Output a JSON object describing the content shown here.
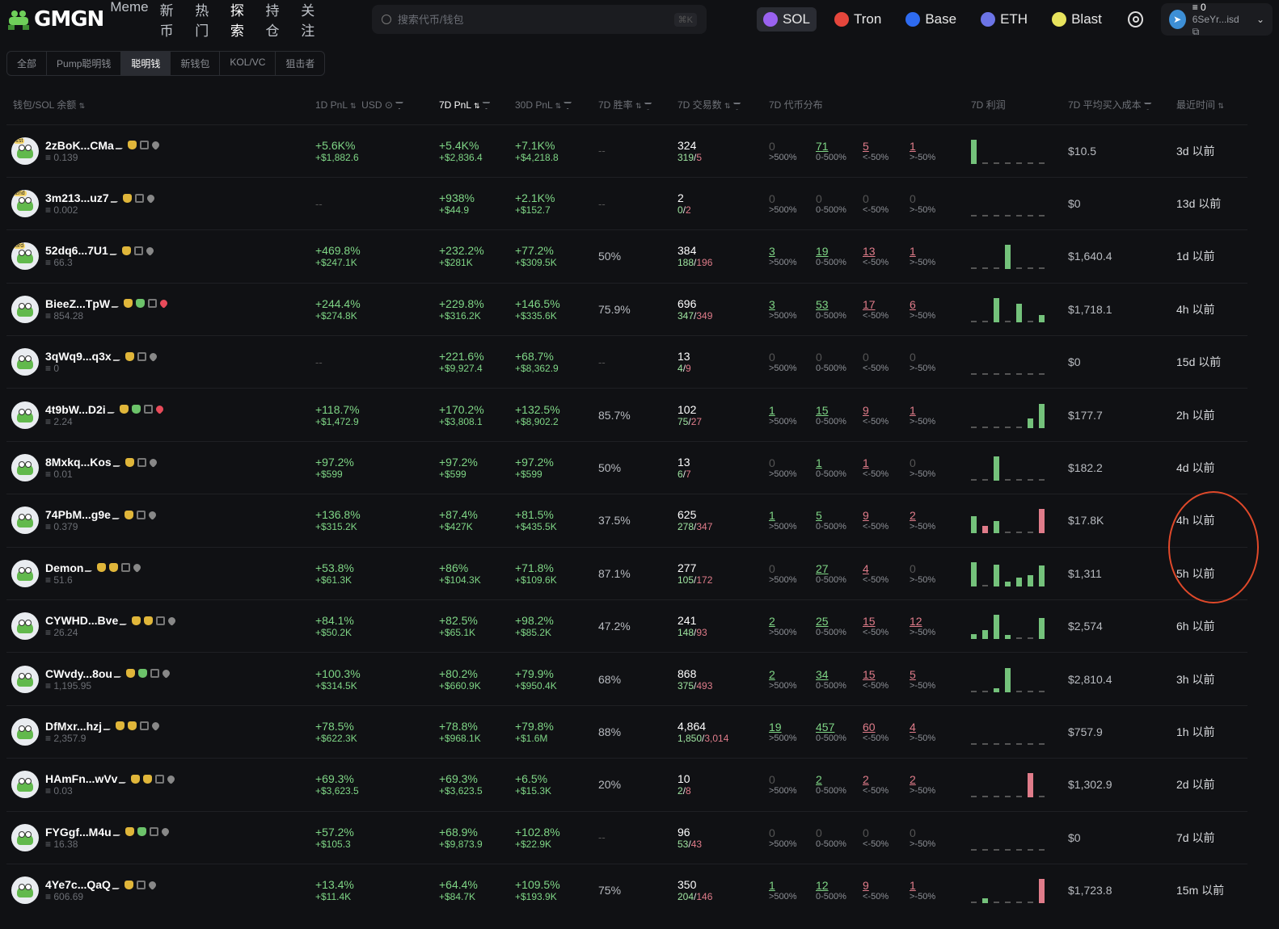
{
  "brand": {
    "name": "GMGN"
  },
  "nav": [
    {
      "label": "Meme"
    },
    {
      "label": "新币"
    },
    {
      "label": "热门"
    },
    {
      "label": "探索",
      "circled": true
    },
    {
      "label": "持仓"
    },
    {
      "label": "关注"
    }
  ],
  "search": {
    "placeholder": "搜索代币/钱包",
    "shortcut": "⌘K"
  },
  "chains": [
    {
      "label": "SOL",
      "color": "#9a62f0",
      "active": true
    },
    {
      "label": "Tron",
      "color": "#e5463c"
    },
    {
      "label": "Base",
      "color": "#2e6bf0"
    },
    {
      "label": "ETH",
      "color": "#6c74e6"
    },
    {
      "label": "Blast",
      "color": "#e7e35d"
    }
  ],
  "wallet": {
    "balance": "0",
    "address": "6SeYr...isd"
  },
  "tabs": [
    {
      "label": "全部"
    },
    {
      "label": "Pump聪明钱"
    },
    {
      "label": "聪明钱",
      "active": true
    },
    {
      "label": "新钱包"
    },
    {
      "label": "KOL/VC"
    },
    {
      "label": "狙击者"
    }
  ],
  "columns": {
    "wallet": "钱包/SOL 余额",
    "pnl1d": "1D PnL",
    "usd": "USD",
    "pnl7d": "7D PnL",
    "pnl30d": "30D PnL",
    "winrate": "7D 胜率",
    "txcount": "7D 交易数",
    "dist": "7D 代币分布",
    "profit": "7D 利润",
    "cost": "7D 平均买入成本",
    "time": "最近时间"
  },
  "dist_labels": [
    ">500%",
    "0-500%",
    "<-50%",
    ">-50%"
  ],
  "colors": {
    "positive": "#7fd686",
    "negative": "#e07c8a",
    "circle": "#e0492a"
  },
  "rows": [
    {
      "rank": "1st",
      "name": "2zBoK...CMa",
      "bal": "0.139",
      "bags": 1,
      "heart": "grey",
      "p1": "+5.6K%",
      "p1u": "+$1,882.6",
      "p7": "+5.4K%",
      "p7u": "+$2,836.4",
      "p30": "+7.1K%",
      "p30u": "+$4,218.8",
      "wr": "--",
      "tx": "324",
      "buy": "319",
      "sell": "5",
      "dist": [
        "0",
        "71",
        "5",
        "1"
      ],
      "bars": [
        1,
        0,
        0,
        0,
        0,
        0,
        0
      ],
      "neg": [],
      "cost": "$10.5",
      "time": "3d 以前"
    },
    {
      "rank": "2nd",
      "name": "3m213...uz7",
      "bal": "0.002",
      "bags": 1,
      "heart": "grey",
      "p1": "--",
      "p1u": "",
      "p7": "+938%",
      "p7u": "+$44.9",
      "p30": "+2.1K%",
      "p30u": "+$152.7",
      "wr": "--",
      "tx": "2",
      "buy": "0",
      "sell": "2",
      "dist": [
        "0",
        "0",
        "0",
        "0"
      ],
      "bars": [
        0,
        0,
        0,
        0,
        0,
        0,
        0
      ],
      "neg": [],
      "cost": "$0",
      "time": "13d 以前"
    },
    {
      "rank": "3rd",
      "name": "52dq6...7U1",
      "bal": "66.3",
      "bags": 1,
      "heart": "grey",
      "p1": "+469.8%",
      "p1u": "+$247.1K",
      "p7": "+232.2%",
      "p7u": "+$281K",
      "p30": "+77.2%",
      "p30u": "+$309.5K",
      "wr": "50%",
      "tx": "384",
      "buy": "188",
      "sell": "196",
      "dist": [
        "3",
        "19",
        "13",
        "1"
      ],
      "bars": [
        0,
        0,
        0,
        1,
        0,
        0,
        0
      ],
      "neg": [],
      "cost": "$1,640.4",
      "time": "1d 以前"
    },
    {
      "rank": "",
      "name": "BieeZ...TpW",
      "bal": "854.28",
      "bags": 1,
      "bagG": true,
      "heart": "red",
      "p1": "+244.4%",
      "p1u": "+$274.8K",
      "p7": "+229.8%",
      "p7u": "+$316.2K",
      "p30": "+146.5%",
      "p30u": "+$335.6K",
      "wr": "75.9%",
      "tx": "696",
      "buy": "347",
      "sell": "349",
      "dist": [
        "3",
        "53",
        "17",
        "6"
      ],
      "bars": [
        0,
        0,
        1,
        0,
        0.75,
        0,
        0.3
      ],
      "neg": [],
      "cost": "$1,718.1",
      "time": "4h 以前"
    },
    {
      "rank": "",
      "name": "3qWq9...q3x",
      "bal": "0",
      "bags": 1,
      "heart": "grey",
      "p1": "--",
      "p1u": "",
      "p7": "+221.6%",
      "p7u": "+$9,927.4",
      "p30": "+68.7%",
      "p30u": "+$8,362.9",
      "wr": "--",
      "tx": "13",
      "buy": "4",
      "sell": "9",
      "dist": [
        "0",
        "0",
        "0",
        "0"
      ],
      "bars": [
        0,
        0,
        0,
        0,
        0,
        0,
        0
      ],
      "neg": [],
      "cost": "$0",
      "time": "15d 以前"
    },
    {
      "rank": "",
      "name": "4t9bW...D2i",
      "bal": "2.24",
      "bags": 1,
      "bagG": true,
      "heart": "red",
      "p1": "+118.7%",
      "p1u": "+$1,472.9",
      "p7": "+170.2%",
      "p7u": "+$3,808.1",
      "p30": "+132.5%",
      "p30u": "+$8,902.2",
      "wr": "85.7%",
      "tx": "102",
      "buy": "75",
      "sell": "27",
      "dist": [
        "1",
        "15",
        "9",
        "1"
      ],
      "bars": [
        0,
        0,
        0,
        0,
        0,
        0.4,
        1
      ],
      "neg": [],
      "cost": "$177.7",
      "time": "2h 以前"
    },
    {
      "rank": "",
      "name": "8Mxkq...Kos",
      "bal": "0.01",
      "bags": 1,
      "heart": "grey",
      "p1": "+97.2%",
      "p1u": "+$599",
      "p7": "+97.2%",
      "p7u": "+$599",
      "p30": "+97.2%",
      "p30u": "+$599",
      "wr": "50%",
      "tx": "13",
      "buy": "6",
      "sell": "7",
      "dist": [
        "0",
        "1",
        "1",
        "0"
      ],
      "bars": [
        0,
        0,
        1,
        0,
        0,
        0,
        0
      ],
      "neg": [],
      "cost": "$182.2",
      "time": "4d 以前"
    },
    {
      "rank": "",
      "name": "74PbM...g9e",
      "bal": "0.379",
      "bags": 1,
      "heart": "grey",
      "p1": "+136.8%",
      "p1u": "+$315.2K",
      "p7": "+87.4%",
      "p7u": "+$427K",
      "p30": "+81.5%",
      "p30u": "+$435.5K",
      "wr": "37.5%",
      "tx": "625",
      "buy": "278",
      "sell": "347",
      "dist": [
        "1",
        "5",
        "9",
        "2"
      ],
      "bars": [
        0.7,
        0.3,
        0.5,
        0,
        0,
        0,
        1
      ],
      "neg": [
        1,
        6
      ],
      "cost": "$17.8K",
      "time": "4h 以前",
      "circled": true
    },
    {
      "rank": "",
      "name": "Demon",
      "bal": "51.6",
      "bags": 2,
      "heart": "grey",
      "p1": "+53.8%",
      "p1u": "+$61.3K",
      "p7": "+86%",
      "p7u": "+$104.3K",
      "p30": "+71.8%",
      "p30u": "+$109.6K",
      "wr": "87.1%",
      "tx": "277",
      "buy": "105",
      "sell": "172",
      "dist": [
        "0",
        "27",
        "4",
        "0"
      ],
      "bars": [
        1,
        0,
        0.9,
        0.2,
        0.35,
        0.45,
        0.85
      ],
      "neg": [],
      "cost": "$1,311",
      "time": "5h 以前",
      "circled": true
    },
    {
      "rank": "",
      "name": "CYWHD...Bve",
      "bal": "26.24",
      "bags": 2,
      "heart": "grey",
      "p1": "+84.1%",
      "p1u": "+$50.2K",
      "p7": "+82.5%",
      "p7u": "+$65.1K",
      "p30": "+98.2%",
      "p30u": "+$85.2K",
      "wr": "47.2%",
      "tx": "241",
      "buy": "148",
      "sell": "93",
      "dist": [
        "2",
        "25",
        "15",
        "12"
      ],
      "bars": [
        0.2,
        0.35,
        1,
        0.15,
        0,
        0,
        0.85
      ],
      "neg": [
        5
      ],
      "cost": "$2,574",
      "time": "6h 以前"
    },
    {
      "rank": "",
      "name": "CWvdy...8ou",
      "bal": "1,195.95",
      "bags": 1,
      "bagG": true,
      "heart": "grey",
      "p1": "+100.3%",
      "p1u": "+$314.5K",
      "p7": "+80.2%",
      "p7u": "+$660.9K",
      "p30": "+79.9%",
      "p30u": "+$950.4K",
      "wr": "68%",
      "tx": "868",
      "buy": "375",
      "sell": "493",
      "dist": [
        "2",
        "34",
        "15",
        "5"
      ],
      "bars": [
        0,
        0,
        0.15,
        1,
        0,
        0,
        0
      ],
      "neg": [],
      "cost": "$2,810.4",
      "time": "3h 以前"
    },
    {
      "rank": "",
      "name": "DfMxr...hzj",
      "bal": "2,357.9",
      "bags": 2,
      "heart": "grey",
      "p1": "+78.5%",
      "p1u": "+$622.3K",
      "p7": "+78.8%",
      "p7u": "+$968.1K",
      "p30": "+79.8%",
      "p30u": "+$1.6M",
      "wr": "88%",
      "tx": "4,864",
      "buy": "1,850",
      "sell": "3,014",
      "dist": [
        "19",
        "457",
        "60",
        "4"
      ],
      "bars": [
        0,
        0,
        0,
        0,
        0,
        0,
        0
      ],
      "neg": [],
      "cost": "$757.9",
      "time": "1h 以前"
    },
    {
      "rank": "",
      "name": "HAmFn...wVv",
      "bal": "0.03",
      "bags": 2,
      "heart": "grey",
      "p1": "+69.3%",
      "p1u": "+$3,623.5",
      "p7": "+69.3%",
      "p7u": "+$3,623.5",
      "p30": "+6.5%",
      "p30u": "+$15.3K",
      "wr": "20%",
      "tx": "10",
      "buy": "2",
      "sell": "8",
      "dist": [
        "0",
        "2",
        "2",
        "2"
      ],
      "bars": [
        0,
        0,
        0,
        0,
        0,
        1,
        0
      ],
      "neg": [
        5
      ],
      "cost": "$1,302.9",
      "time": "2d 以前"
    },
    {
      "rank": "",
      "name": "FYGgf...M4u",
      "bal": "16.38",
      "bags": 1,
      "bagG": true,
      "heart": "grey",
      "p1": "+57.2%",
      "p1u": "+$105.3",
      "p7": "+68.9%",
      "p7u": "+$9,873.9",
      "p30": "+102.8%",
      "p30u": "+$22.9K",
      "wr": "--",
      "tx": "96",
      "buy": "53",
      "sell": "43",
      "dist": [
        "0",
        "0",
        "0",
        "0"
      ],
      "bars": [
        0,
        0,
        0,
        0,
        0,
        0,
        0
      ],
      "neg": [],
      "cost": "$0",
      "time": "7d 以前"
    },
    {
      "rank": "",
      "name": "4Ye7c...QaQ",
      "bal": "606.69",
      "bags": 1,
      "heart": "grey",
      "p1": "+13.4%",
      "p1u": "+$11.4K",
      "p7": "+64.4%",
      "p7u": "+$84.7K",
      "p30": "+109.5%",
      "p30u": "+$193.9K",
      "wr": "75%",
      "tx": "350",
      "buy": "204",
      "sell": "146",
      "dist": [
        "1",
        "12",
        "9",
        "1"
      ],
      "bars": [
        0,
        0.2,
        0,
        0,
        0,
        0,
        1
      ],
      "neg": [
        6
      ],
      "cost": "$1,723.8",
      "time": "15m 以前"
    }
  ]
}
